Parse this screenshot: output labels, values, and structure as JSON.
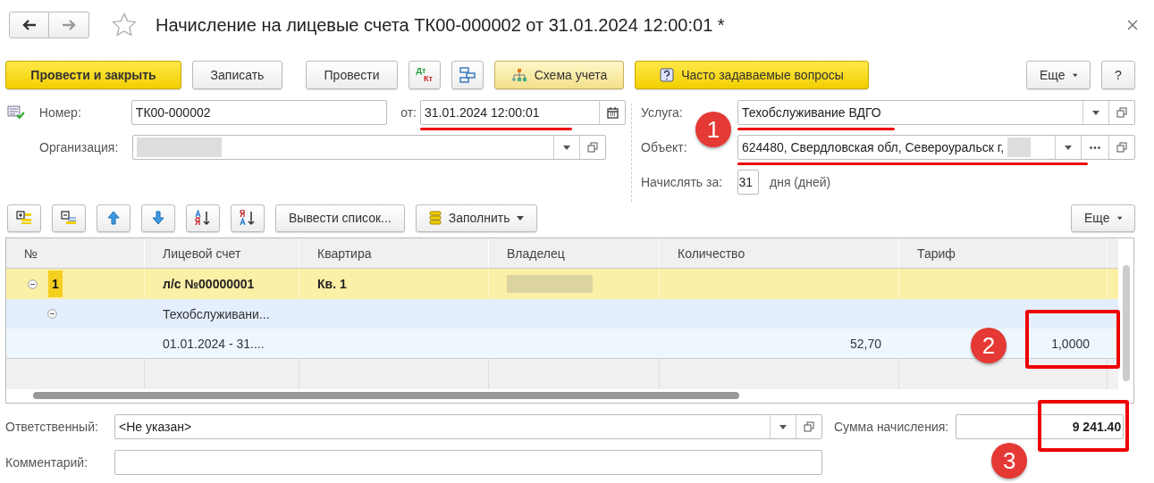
{
  "window": {
    "title": "Начисление на лицевые счета ТК00-000002 от 31.01.2024 12:00:01 *",
    "favorite": false
  },
  "toolbar": [
    {
      "kind": "primary",
      "label": "Провести и закрыть"
    },
    {
      "kind": "plain",
      "label": "Записать"
    },
    {
      "kind": "plain",
      "label": "Провести"
    },
    {
      "kind": "dtkt",
      "top": "Дт",
      "bottom": "Кт"
    },
    {
      "kind": "structure"
    },
    {
      "kind": "scheme",
      "label": "Схема учета"
    },
    {
      "kind": "faq",
      "label": "Часто задаваемые вопросы"
    }
  ],
  "toolbar_right": [
    {
      "kind": "more",
      "label": "Еще"
    },
    {
      "kind": "help",
      "label": "?"
    }
  ],
  "form": {
    "number_label": "Номер:",
    "number": "ТК00-000002",
    "date_label": "от:",
    "date": "31.01.2024 12:00:01",
    "date_underlined": true,
    "org_label": "Организация:",
    "org_redacted": true,
    "service_label": "Услуга:",
    "service": "Техобслуживание ВДГО",
    "service_underlined": true,
    "object_label": "Объект:",
    "object": "624480, Свердловская обл, Североуральск г,",
    "object_redacted": true,
    "object_underlined": true,
    "days_label": "Начислять за:",
    "days": "31",
    "days_unit": "дня (дней)"
  },
  "table_toolbar": [
    {
      "kind": "add-group"
    },
    {
      "kind": "remove-group"
    },
    {
      "kind": "up"
    },
    {
      "kind": "down"
    },
    {
      "kind": "sort-asc"
    },
    {
      "kind": "sort-desc"
    },
    {
      "kind": "text",
      "label": "Вывести список..."
    },
    {
      "kind": "fill",
      "label": "Заполнить"
    }
  ],
  "table_more": "Еще",
  "table": {
    "columns": [
      "№",
      "Лицевой счет",
      "Квартира",
      "Владелец",
      "Количество",
      "Тариф"
    ],
    "rows": [
      {
        "kind": "account",
        "expanded": true,
        "number": "1",
        "account": "л/с №00000001",
        "apartment": "Кв. 1",
        "owner_redacted": true
      },
      {
        "kind": "service",
        "expanded": true,
        "account": "Техобслуживани..."
      },
      {
        "kind": "period",
        "account": "01.01.2024 - 31....",
        "quantity": "52,70",
        "tariff": "1,0000",
        "tariff_highlighted": true
      }
    ]
  },
  "footer": {
    "responsible_label": "Ответственный:",
    "responsible": "<Не указан>",
    "comment_label": "Комментарий:",
    "sum_label": "Сумма начисления:",
    "sum": "9 241.40",
    "sum_highlighted": true
  },
  "annotations": [
    "1",
    "2",
    "3"
  ]
}
